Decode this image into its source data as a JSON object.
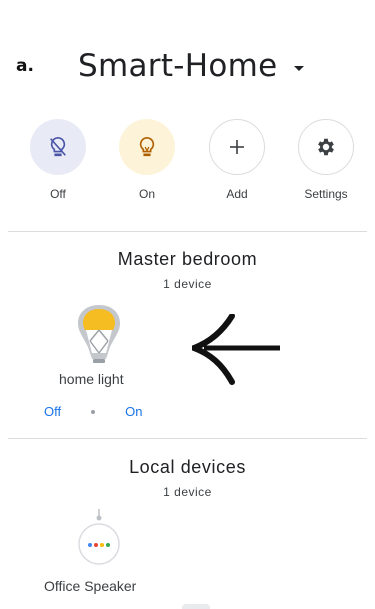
{
  "annotation": {
    "label": "a."
  },
  "header": {
    "home_name": "Smart-Home"
  },
  "actions": [
    {
      "label": "Off",
      "icon": "bulb-off-icon"
    },
    {
      "label": "On",
      "icon": "bulb-on-icon"
    },
    {
      "label": "Add",
      "icon": "plus-icon"
    },
    {
      "label": "Settings",
      "icon": "gear-icon"
    }
  ],
  "rooms": [
    {
      "title": "Master bedroom",
      "count": "1 device",
      "devices": [
        {
          "name": "home light",
          "icon": "light-bulb-icon",
          "off_label": "Off",
          "on_label": "On"
        }
      ]
    },
    {
      "title": "Local devices",
      "count": "1 device",
      "devices": [
        {
          "name": "Office Speaker",
          "icon": "google-home-mini-icon"
        }
      ]
    }
  ],
  "colors": {
    "off_bg": "#e8eaf6",
    "on_bg": "#fdf3d8",
    "link": "#1a73e8",
    "bulb_yellow": "#f5bd22"
  }
}
